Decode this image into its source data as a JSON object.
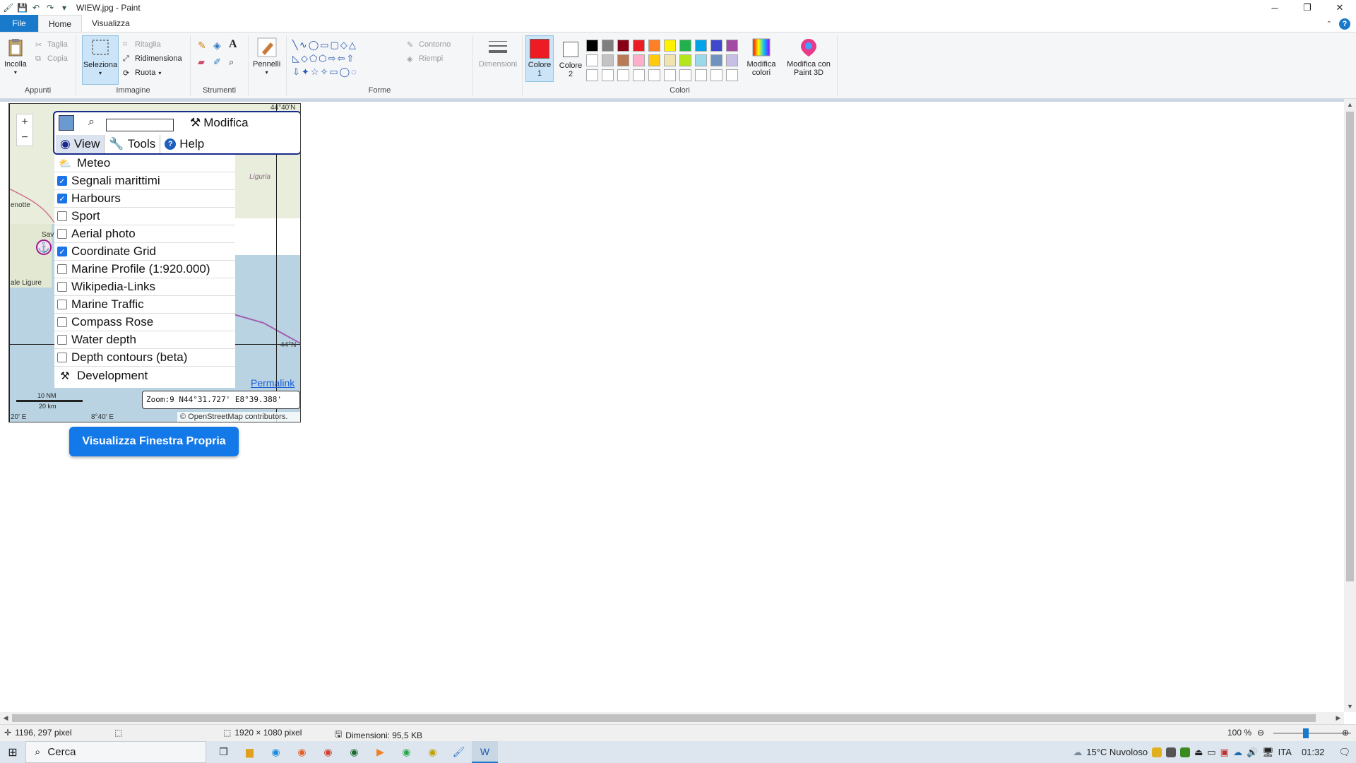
{
  "window": {
    "title": "WIEW.jpg - Paint",
    "controls": {
      "minimize": "─",
      "maximize": "❐",
      "close": "✕"
    }
  },
  "tabs": [
    {
      "label": "File"
    },
    {
      "label": "Home"
    },
    {
      "label": "Visualizza"
    }
  ],
  "ribbon": {
    "clipboard": {
      "paste": "Incolla",
      "cut": "Taglia",
      "copy": "Copia",
      "group": "Appunti"
    },
    "image": {
      "select": "Seleziona",
      "crop": "Ritaglia",
      "resize": "Ridimensiona",
      "rotate": "Ruota",
      "group": "Immagine"
    },
    "tools": {
      "group": "Strumenti",
      "text_tool": "A"
    },
    "brushes": {
      "label": "Pennelli"
    },
    "shapes": {
      "outline": "Contorno",
      "fill": "Riempi",
      "group": "Forme"
    },
    "size": {
      "label": "Dimensioni"
    },
    "colors": {
      "color1": "Colore 1",
      "color2": "Colore 2",
      "group": "Colori",
      "edit": "Modifica colori",
      "paint3d": "Modifica con Paint 3D",
      "color1_value": "#ed1c24",
      "color2_value": "#ffffff",
      "palette_row1": [
        "#000000",
        "#7f7f7f",
        "#880015",
        "#ed1c24",
        "#ff7f27",
        "#fff200",
        "#22b14c",
        "#00a2e8",
        "#3f48cc",
        "#a349a4"
      ],
      "palette_row2": [
        "#ffffff",
        "#c3c3c3",
        "#b97a57",
        "#ffaec9",
        "#ffc90e",
        "#efe4b0",
        "#b5e61d",
        "#99d9ea",
        "#7092be",
        "#c8bfe7"
      ],
      "palette_row3": [
        "#ffffff",
        "#ffffff",
        "#ffffff",
        "#ffffff",
        "#ffffff",
        "#ffffff",
        "#ffffff",
        "#ffffff",
        "#ffffff",
        "#ffffff"
      ]
    }
  },
  "map": {
    "toolbar": {
      "edit": "Modifica",
      "view": "View",
      "tools": "Tools",
      "help": "Help"
    },
    "menu": {
      "meteo": "Meteo",
      "items": [
        {
          "label": "Segnali marittimi",
          "checked": true
        },
        {
          "label": "Harbours",
          "checked": true
        },
        {
          "label": "Sport",
          "checked": false
        },
        {
          "label": "Aerial photo",
          "checked": false
        },
        {
          "label": "Coordinate Grid",
          "checked": true
        },
        {
          "label": "Marine Profile (1:920.000)",
          "checked": false
        },
        {
          "label": "Wikipedia-Links",
          "checked": false
        },
        {
          "label": "Marine Traffic",
          "checked": false
        },
        {
          "label": "Compass Rose",
          "checked": false
        },
        {
          "label": "Water depth",
          "checked": false
        },
        {
          "label": "Depth contours (beta)",
          "checked": false
        }
      ],
      "development": "Development"
    },
    "zoom_in": "+",
    "zoom_out": "−",
    "permalink": "Permalink",
    "coords": "Zoom:9 N44°31.727' E8°39.388'",
    "attribution": "© OpenStreetMap contributors.",
    "scale_nm": "10 NM",
    "scale_km": "20 km",
    "labels": {
      "liguria": "Liguria",
      "enotte": "enotte",
      "sav": "Sav",
      "ale_ligure": "ale Ligure",
      "lat_top": "44°40'N",
      "lat_mid": "44°N",
      "lon_left": "20' E",
      "lon_mid": "8°40' E"
    }
  },
  "page_button": "Visualizza Finestra Propria",
  "status": {
    "cursor": "1196, 297 pixel",
    "size": "1920 × 1080 pixel",
    "file_size": "Dimensioni: 95,5 KB",
    "zoom": "100 %"
  },
  "taskbar": {
    "search": "Cerca",
    "weather": "15°C  Nuvoloso",
    "lang": "ITA",
    "time": "01:32"
  }
}
